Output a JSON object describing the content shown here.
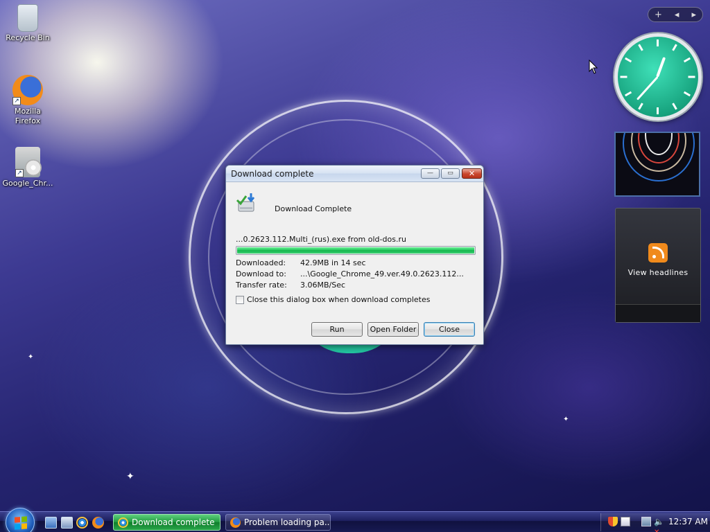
{
  "desktop": {
    "icons": [
      {
        "label": "Recycle Bin"
      },
      {
        "label": "Mozilla Firefox"
      },
      {
        "label": "Google_Chr..."
      }
    ]
  },
  "sidebar": {
    "add_label": "+",
    "prev_label": "◂",
    "next_label": "▸",
    "feed_label": "View headlines"
  },
  "dialog": {
    "title": "Download complete",
    "header": "Download Complete",
    "filename": "...0.2623.112.Multi_(rus).exe from old-dos.ru",
    "progress_percent": 100,
    "rows": [
      {
        "key": "Downloaded:",
        "value": "42.9MB in 14 sec"
      },
      {
        "key": "Download to:",
        "value": "...\\Google_Chrome_49.ver.49.0.2623.112..."
      },
      {
        "key": "Transfer rate:",
        "value": "3.06MB/Sec"
      }
    ],
    "checkbox_label": "Close this dialog box when download completes",
    "checkbox_checked": false,
    "buttons": {
      "run": "Run",
      "open_folder": "Open Folder",
      "close": "Close"
    },
    "window_buttons": {
      "minimize": "—",
      "maximize": "▭",
      "close": "✕"
    }
  },
  "taskbar": {
    "items": [
      {
        "label": "Download complete",
        "active": true
      },
      {
        "label": "Problem loading pa...",
        "active": false
      }
    ],
    "clock": "12:37 AM"
  },
  "colors": {
    "progress_fill": "#1bc455",
    "active_task": "#1f9a3e",
    "clock_face": "#17a37e"
  }
}
